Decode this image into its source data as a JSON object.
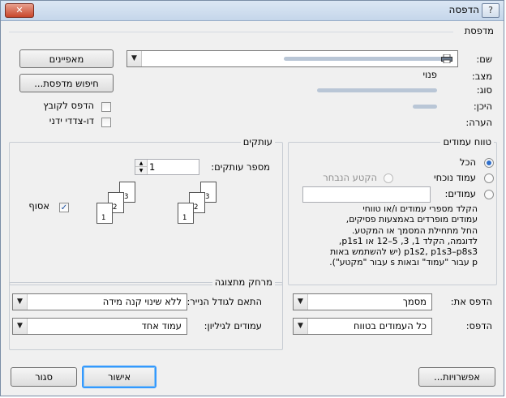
{
  "window": {
    "title": "הדפסה",
    "help_glyph": "?",
    "close_glyph": "✕"
  },
  "printer": {
    "group_label": "מדפסת",
    "name_label": "שם:",
    "status_label": "מצב:",
    "status_value": "פנוי",
    "type_label": "סוג:",
    "where_label": "היכן:",
    "comment_label": "הערה:",
    "properties_button": "מאפיינים",
    "find_printer_button": "חיפוש מדפסת...",
    "print_to_file_label": "הדפס לקובץ",
    "manual_duplex_label": "דו-צדדי ידני",
    "combo_arrow": "▼"
  },
  "page_range": {
    "group_label": "טווח עמודים",
    "all_label": "הכל",
    "current_page_label": "עמוד נוכחי",
    "selection_label": "הקטע הנבחר",
    "pages_label": "עמודים:",
    "help_lines": [
      "הקלד מספרי עמודים ו/או טווחי",
      "עמודים מופרדים באמצעות פסיקים,",
      "החל מתחילת המסמך או המקטע.",
      "לדוגמה, הקלד 1, 3, 5–12 או p1s1,",
      "p1s2, p1s3–p8s3 (יש להשתמש באות",
      "p עבור \"עמוד\" ובאות s עבור \"מקטע\")."
    ]
  },
  "copies": {
    "group_label": "עותקים",
    "count_label": "מספר עותקים:",
    "count_value": "1",
    "collate_label": "אסוף",
    "collate_checked": true,
    "collate_pages": [
      "1",
      "2",
      "3",
      "1",
      "2",
      "3"
    ],
    "spin_up": "▲",
    "spin_down": "▼"
  },
  "print_what": {
    "label": "הדפס את:",
    "value": "מסמך"
  },
  "print": {
    "label": "הדפס:",
    "value": "כל העמודים בטווח"
  },
  "zoom": {
    "group_label": "מרחק מתצוגה",
    "pages_per_sheet_label": "עמודים לגיליון:",
    "pages_per_sheet_value": "עמוד אחד",
    "scale_label": "התאם לגודל הנייר:",
    "scale_value": "ללא שינוי קנה מידה"
  },
  "buttons": {
    "options": "אפשרויות...",
    "ok": "אישור",
    "cancel": "סגור"
  }
}
